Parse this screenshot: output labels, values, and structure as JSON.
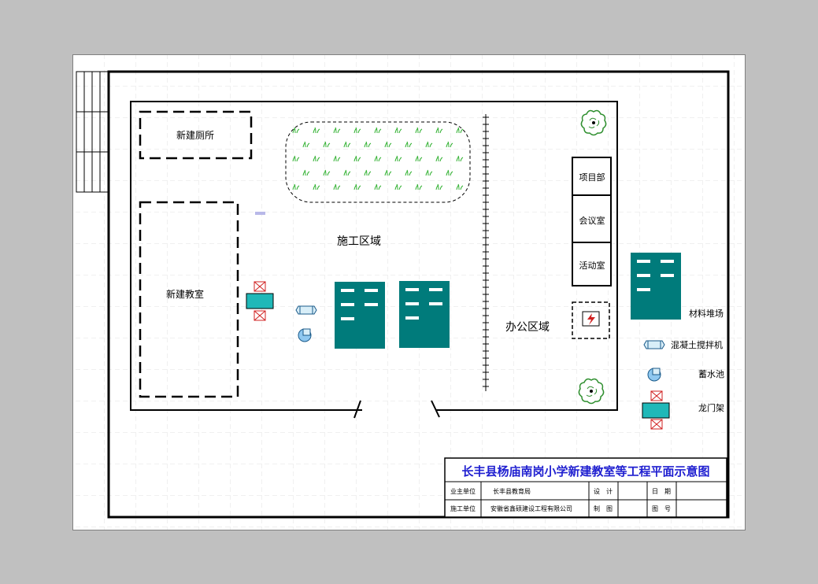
{
  "plan": {
    "areas": {
      "new_toilet": "新建厕所",
      "new_classroom": "新建教室",
      "construction_area": "施工区域",
      "office_area": "办公区域"
    },
    "rooms": [
      "项目部",
      "会议室",
      "活动室"
    ],
    "legend": {
      "material_yard": "材料堆场",
      "mixer": "混凝土搅拌机",
      "reservoir": "蓄水池",
      "gantry": "龙门架"
    }
  },
  "title_block": {
    "title": "长丰县杨庙南岗小学新建教室等工程平面示意图",
    "owner_label": "业主单位",
    "owner_value": "长丰县教育局",
    "builder_label": "施工单位",
    "builder_value": "安徽省鑫硕建设工程有限公司",
    "design_label": "设　计",
    "draw_label": "制　图",
    "date_label": "日　期",
    "drawing_no_label": "图　号"
  },
  "colors": {
    "block_fill": "#007b7b",
    "gantry_fill": "#20b8b8",
    "title_color": "#1f1fd0",
    "grass": "#2fb02f",
    "tree": "#2f8f2f",
    "device": "#4aa0e0"
  }
}
